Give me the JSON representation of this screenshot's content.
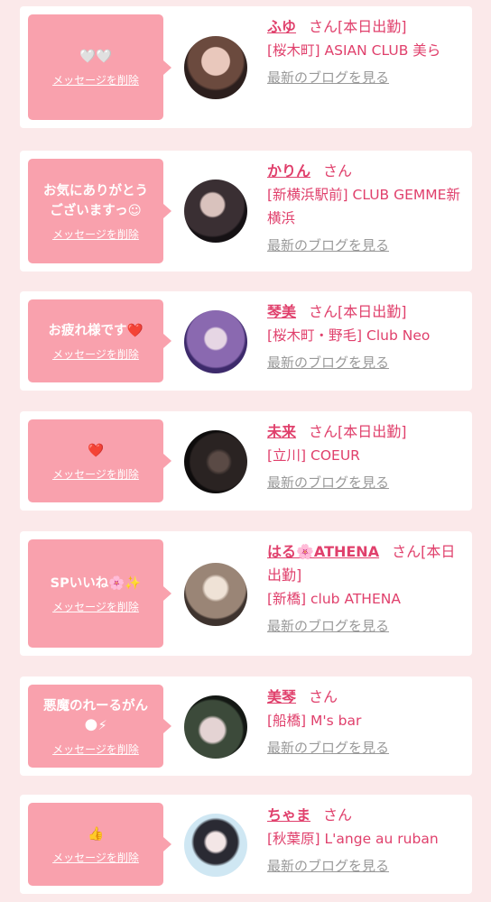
{
  "colors": {
    "accent": "#e0406c",
    "bubble": "#f9a1ad",
    "background": "#fbe9ea",
    "link_gray": "#999999"
  },
  "common": {
    "delete_label": "メッセージを削除",
    "san": "さん",
    "blog_label": "最新のブログを見る"
  },
  "cards": [
    {
      "message": "🤍🤍",
      "name": "ふゆ",
      "status": "[本日出勤]",
      "shop": "[桜木町] ASIAN CLUB 美ら"
    },
    {
      "message": "お気にありがとう\nございますっ☺",
      "name": "かりん",
      "status": "",
      "shop": "[新横浜駅前] CLUB GEMME新横浜"
    },
    {
      "message": "お疲れ様です❤️",
      "name": "琴美",
      "status": "[本日出勤]",
      "shop": "[桜木町・野毛] Club Neo"
    },
    {
      "message": "❤️",
      "name": "未来",
      "status": "[本日出勤]",
      "shop": "[立川] COEUR"
    },
    {
      "message": "SPいいね🌸✨",
      "name": "はる🌸ATHENA",
      "status": "[本日出勤]",
      "shop": "[新橋] club ATHENA"
    },
    {
      "message": "悪魔のれーるがん\n🌑⚡",
      "name": "美琴",
      "status": "",
      "shop": "[船橋] M's bar"
    },
    {
      "message": "👍",
      "name": "ちゃま",
      "status": "",
      "shop": "[秋葉原] L'ange au ruban"
    }
  ]
}
